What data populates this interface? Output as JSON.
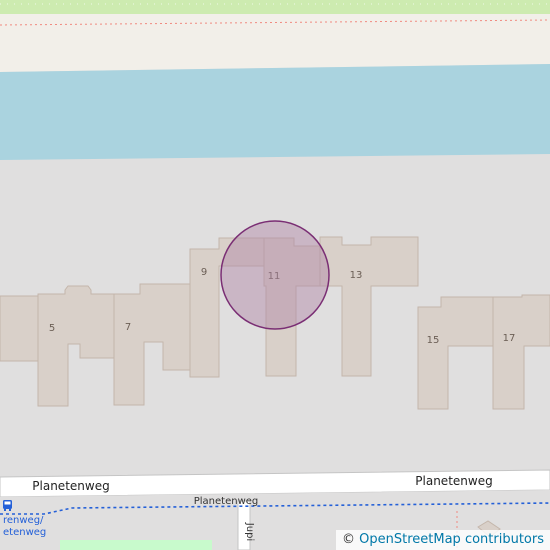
{
  "map": {
    "colors": {
      "background": "#e0dfdf",
      "water": "#aad3df",
      "building": "#d9d0c9",
      "building_stroke": "#c4b6ab",
      "road": "#ffffff",
      "road_stroke": "#c5c5c5",
      "grass": "#c8facc",
      "promenade": "#f2efe9",
      "marker_fill": "#b085a6",
      "marker_stroke": "#7a2e74",
      "bus_route": "#2460d8"
    },
    "buildings": [
      {
        "number": "5"
      },
      {
        "number": "7"
      },
      {
        "number": "9"
      },
      {
        "number": "11"
      },
      {
        "number": "13"
      },
      {
        "number": "15"
      },
      {
        "number": "17"
      }
    ],
    "streets": {
      "main_top_left": "Planetenweg",
      "main_top_right": "Planetenweg",
      "main_lower": "Planetenweg",
      "side_vertical": "Jupi",
      "bus_stop_line1": "renweg/",
      "bus_stop_line2": "etenweg"
    },
    "icons": {
      "bus_stop": "bus-icon"
    }
  },
  "attribution": {
    "symbol": "©",
    "link_text": "OpenStreetMap contributors"
  }
}
